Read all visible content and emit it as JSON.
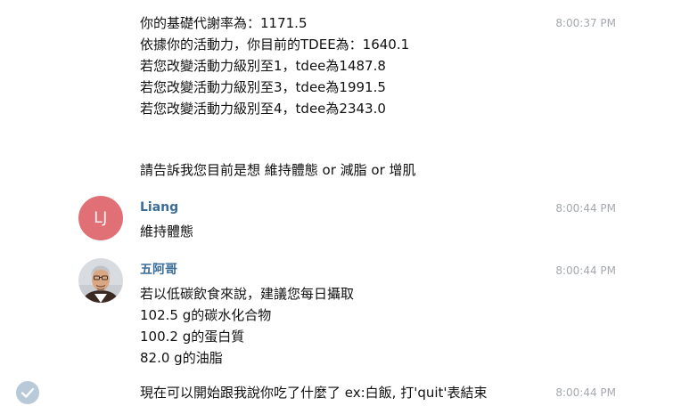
{
  "messages": [
    {
      "time": "8:00:37 PM",
      "lines": [
        "你的基礎代謝率為：1171.5",
        "依據你的活動力，你目前的TDEE為：1640.1",
        "若您改變活動力級別至1，tdee為1487.8",
        "若您改變活動力級別至3，tdee為1991.5",
        "若您改變活動力級別至4，tdee為2343.0",
        "請告訴我您目前是想 維持體態 or 減脂 or 增肌"
      ]
    },
    {
      "sender": "Liang",
      "avatar_initials": "LJ",
      "time": "8:00:44 PM",
      "lines": [
        "維持體態"
      ]
    },
    {
      "sender": "五阿哥",
      "time": "8:00:44 PM",
      "lines": [
        "若以低碳飲食來說，建議您每日攝取",
        "102.5 g的碳水化合物",
        "100.2 g的蛋白質",
        "82.0 g的油脂"
      ]
    },
    {
      "time": "8:00:44 PM",
      "lines": [
        "現在可以開始跟我說你吃了什麼了 ex:白飯, 打'quit'表結束"
      ]
    }
  ],
  "colors": {
    "sender_name": "#3a6d99",
    "timestamp": "#a4a8ac",
    "avatar_lj_bg": "#e17076",
    "check_bg": "#b8cad8"
  },
  "icons": [
    "check-icon"
  ]
}
